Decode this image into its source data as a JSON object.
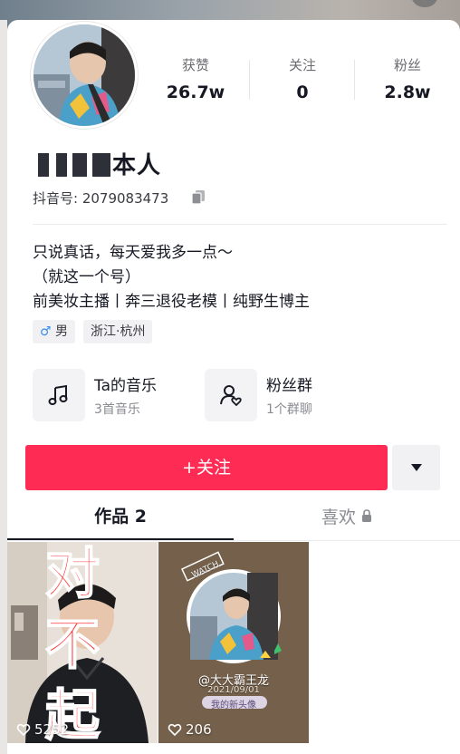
{
  "profile": {
    "name_visible": "本人",
    "douyin_id_label": "抖音号: 2079083473",
    "bio_lines": [
      "只说真话，每天爱我多一点～",
      "（就这一个号）",
      "前美妆主播丨奔三退役老模丨纯野生博主"
    ],
    "tags": [
      {
        "label": "男",
        "icon": "male-icon"
      },
      {
        "label": "浙江·杭州"
      }
    ]
  },
  "stats": [
    {
      "label": "获赞",
      "value": "26.7w"
    },
    {
      "label": "关注",
      "value": "0"
    },
    {
      "label": "粉丝",
      "value": "2.8w"
    }
  ],
  "tiles": [
    {
      "title": "Ta的音乐",
      "subtitle": "3首音乐",
      "icon": "music-note-icon"
    },
    {
      "title": "粉丝群",
      "subtitle": "1个群聊",
      "icon": "fan-group-icon"
    }
  ],
  "actions": {
    "follow_label": "+关注",
    "more_icon": "triangle-down-icon"
  },
  "tabs": [
    {
      "label": "作品 2",
      "active": true
    },
    {
      "label": "喜欢",
      "locked": true
    }
  ],
  "videos": [
    {
      "likes": "5252",
      "overlay_chars": [
        "对",
        "不",
        "起"
      ]
    },
    {
      "likes": "206",
      "watermark": "WATCH",
      "caption_handle": "@大大霸王龙",
      "caption_date": "2021/09/01",
      "caption_tag": "我的新头像"
    }
  ],
  "colors": {
    "accent": "#fe2c55",
    "text": "#161823",
    "muted": "#8a8b91"
  }
}
